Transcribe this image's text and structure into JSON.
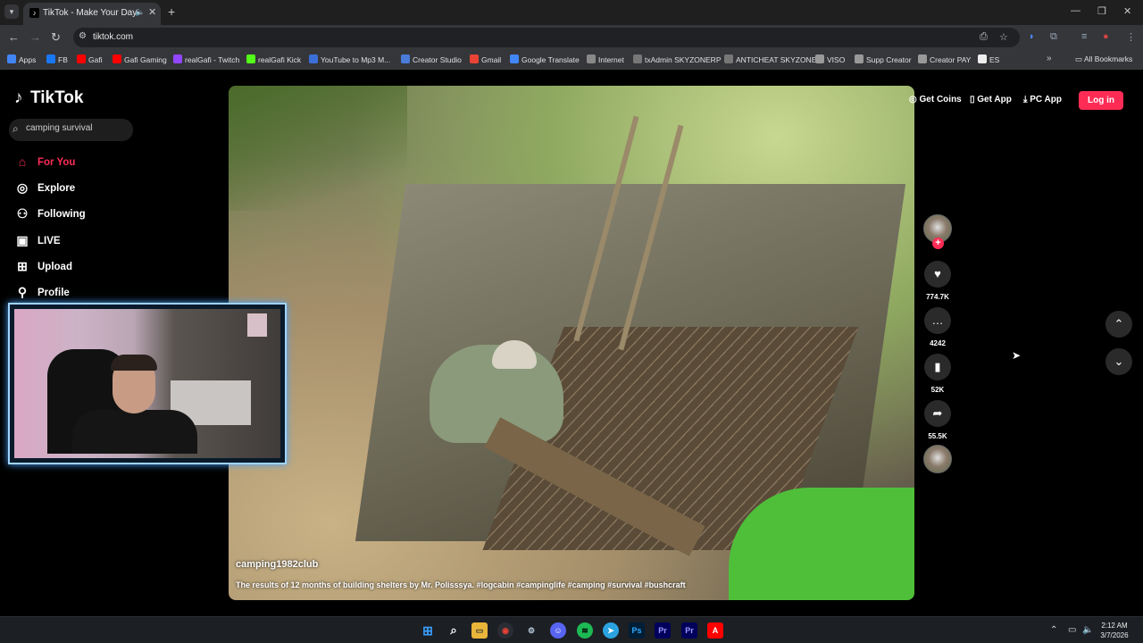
{
  "browser": {
    "tab_title": "TikTok - Make Your Day",
    "url": "tiktok.com",
    "bookmarks": [
      {
        "label": "Apps",
        "color": "#4285f4"
      },
      {
        "label": "FB",
        "color": "#1877f2"
      },
      {
        "label": "Gafi",
        "color": "#ff0000"
      },
      {
        "label": "Gafi Gaming",
        "color": "#ff0000"
      },
      {
        "label": "realGafi - Twitch",
        "color": "#9146ff"
      },
      {
        "label": "realGafi Kick",
        "color": "#53fc18"
      },
      {
        "label": "YouTube to Mp3 M...",
        "color": "#3b6fd8"
      },
      {
        "label": "Creator Studio",
        "color": "#4a7bd8"
      },
      {
        "label": "Gmail",
        "color": "#ea4335"
      },
      {
        "label": "Google Translate",
        "color": "#4285f4"
      },
      {
        "label": "Internet",
        "color": "#888888"
      },
      {
        "label": "txAdmin SKYZONERP",
        "color": "#777777"
      },
      {
        "label": "ANTICHEAT SKYZONE",
        "color": "#777777"
      },
      {
        "label": "VISO",
        "color": "#999999"
      },
      {
        "label": "Supp Creator",
        "color": "#999999"
      },
      {
        "label": "Creator PAY",
        "color": "#999999"
      },
      {
        "label": "ES",
        "color": "#eeeeee"
      }
    ],
    "all_bookmarks": "All Bookmarks"
  },
  "sidebar": {
    "logo": "TikTok",
    "search_value": "camping survival",
    "nav": [
      {
        "label": "For You",
        "icon": "home-icon"
      },
      {
        "label": "Explore",
        "icon": "compass-icon"
      },
      {
        "label": "Following",
        "icon": "people-icon"
      },
      {
        "label": "LIVE",
        "icon": "live-icon"
      },
      {
        "label": "Upload",
        "icon": "plus-square-icon"
      },
      {
        "label": "Profile",
        "icon": "person-icon"
      }
    ]
  },
  "header": {
    "get_coins": "Get Coins",
    "get_app": "Get App",
    "pc_app": "PC App",
    "login": "Log in"
  },
  "video": {
    "username": "camping1982club",
    "caption": "The results of 12 months of building shelters by Mr. Polisssya. #logcabin #campinglife #camping #survival #bushcraft"
  },
  "actions": {
    "likes": "774.7K",
    "comments": "4242",
    "saves": "52K",
    "shares": "55.5K"
  },
  "accent_color": "#fe2c55",
  "taskbar": {
    "time": "2:12 AM",
    "date": "3/7/2026"
  }
}
